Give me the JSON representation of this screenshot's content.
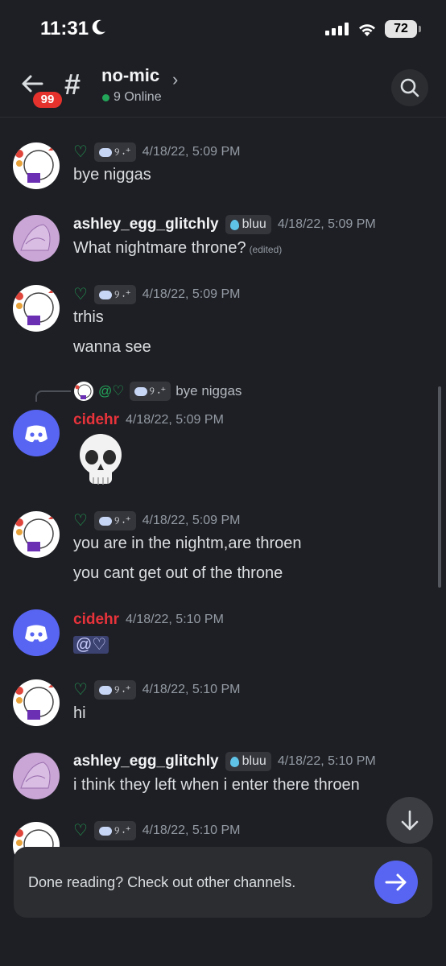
{
  "status": {
    "time": "11:31",
    "battery": "72"
  },
  "header": {
    "channel": "no-mic",
    "online": "9 Online",
    "unread_count": "99"
  },
  "messages": [
    {
      "author": "",
      "heart": "♡",
      "deco": "୨",
      "timestamp": "4/18/22, 5:09 PM",
      "lines": [
        "bye niggas"
      ]
    },
    {
      "author": "ashley_egg_glitchly",
      "role": "bluu",
      "timestamp": "4/18/22, 5:09 PM",
      "lines": [
        "What nightmare throne?"
      ],
      "edited": "(edited)"
    },
    {
      "author": "",
      "heart": "♡",
      "deco": "୨",
      "timestamp": "4/18/22, 5:09 PM",
      "lines": [
        "trhis",
        "wanna see"
      ]
    },
    {
      "reply": {
        "mention": "@♡",
        "deco": "୨",
        "text": "bye niggas"
      },
      "author": "cidehr",
      "timestamp": "4/18/22, 5:09 PM",
      "emoji": "skull"
    },
    {
      "author": "",
      "heart": "♡",
      "deco": "୨",
      "timestamp": "4/18/22, 5:09 PM",
      "lines": [
        "you are in the nightm,are throen",
        "you cant get out of the throne"
      ]
    },
    {
      "author": "cidehr",
      "timestamp": "4/18/22, 5:10 PM",
      "mention": "@♡"
    },
    {
      "author": "",
      "heart": "♡",
      "deco": "୨",
      "timestamp": "4/18/22, 5:10 PM",
      "lines": [
        "hi"
      ]
    },
    {
      "author": "ashley_egg_glitchly",
      "role": "bluu",
      "timestamp": "4/18/22, 5:10 PM",
      "lines": [
        "i think they left when i enter there throen"
      ]
    },
    {
      "author": "",
      "heart": "♡",
      "deco": "୨",
      "timestamp": "4/18/22, 5:10 PM",
      "lines": []
    }
  ],
  "banner": {
    "text": "Done reading? Check out other channels."
  },
  "colors": {
    "accent": "#5865f2",
    "online": "#23a55a",
    "badge": "#e5322d",
    "username_red": "#e8333b"
  }
}
